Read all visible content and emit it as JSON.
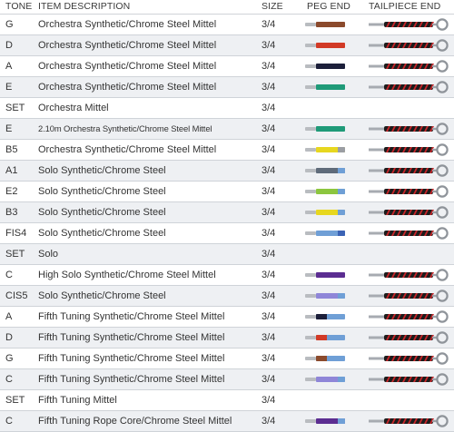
{
  "header": {
    "tone": "TONE",
    "description": "ITEM DESCRIPTION",
    "size": "SIZE",
    "peg_end": "PEG END",
    "tailpiece_end": "TAILPIECE END"
  },
  "rows": [
    {
      "tone": "G",
      "description": "Orchestra Synthetic/Chrome Steel Mittel",
      "size": "3/4",
      "peg": {
        "main": "#8b4a2c"
      },
      "tail": true
    },
    {
      "tone": "D",
      "description": "Orchestra Synthetic/Chrome Steel Mittel",
      "size": "3/4",
      "peg": {
        "main": "#d23a26"
      },
      "tail": true
    },
    {
      "tone": "A",
      "description": "Orchestra Synthetic/Chrome Steel Mittel",
      "size": "3/4",
      "peg": {
        "main": "#1c1f3a"
      },
      "tail": true
    },
    {
      "tone": "E",
      "description": "Orchestra Synthetic/Chrome Steel Mittel",
      "size": "3/4",
      "peg": {
        "main": "#1f9a78"
      },
      "tail": true
    },
    {
      "tone": "SET",
      "description": "Orchestra Mittel",
      "size": "3/4",
      "peg": null,
      "tail": false
    },
    {
      "tone": "E",
      "description": "2.10m Orchestra Synthetic/Chrome Steel Mittel",
      "size": "3/4",
      "small": true,
      "peg": {
        "main": "#1f9a78"
      },
      "tail": true
    },
    {
      "tone": "B5",
      "description": "Orchestra Synthetic/Chrome Steel Mittel",
      "size": "3/4",
      "peg": {
        "main": "#e7d71f",
        "tip": "#9b9ea3"
      },
      "tail": true
    },
    {
      "tone": "A1",
      "description": "Solo Synthetic/Chrome Steel",
      "size": "3/4",
      "peg": {
        "main": "#5f6b7a",
        "tip": "#6f9fd6"
      },
      "tail": true
    },
    {
      "tone": "E2",
      "description": "Solo Synthetic/Chrome Steel",
      "size": "3/4",
      "peg": {
        "main": "#8cc63f",
        "tip": "#6f9fd6"
      },
      "tail": true
    },
    {
      "tone": "B3",
      "description": "Solo Synthetic/Chrome Steel",
      "size": "3/4",
      "peg": {
        "main": "#e7d71f",
        "tip": "#6f9fd6"
      },
      "tail": true
    },
    {
      "tone": "FIS4",
      "description": "Solo Synthetic/Chrome Steel",
      "size": "3/4",
      "peg": {
        "main": "#6f9fd6",
        "tip": "#3b63b5"
      },
      "tail": true
    },
    {
      "tone": "SET",
      "description": "Solo",
      "size": "3/4",
      "peg": null,
      "tail": false
    },
    {
      "tone": "C",
      "description": "High Solo Synthetic/Chrome Steel Mittel",
      "size": "3/4",
      "peg": {
        "main": "#5b2d91"
      },
      "tail": true
    },
    {
      "tone": "CIS5",
      "description": "Solo Synthetic/Chrome Steel",
      "size": "3/4",
      "peg": {
        "main": "#8f86d8",
        "tip": "#6f9fd6"
      },
      "tail": true
    },
    {
      "tone": "A",
      "description": "Fifth Tuning Synthetic/Chrome Steel Mittel",
      "size": "3/4",
      "peg": {
        "main": "#6f9fd6",
        "head": "#1c1f3a"
      },
      "tail": true
    },
    {
      "tone": "D",
      "description": "Fifth Tuning Synthetic/Chrome Steel Mittel",
      "size": "3/4",
      "peg": {
        "main": "#6f9fd6",
        "head": "#d23a26"
      },
      "tail": true
    },
    {
      "tone": "G",
      "description": "Fifth Tuning Synthetic/Chrome Steel Mittel",
      "size": "3/4",
      "peg": {
        "main": "#6f9fd6",
        "head": "#8b4a2c"
      },
      "tail": true
    },
    {
      "tone": "C",
      "description": "Fifth Tuning Synthetic/Chrome Steel Mittel",
      "size": "3/4",
      "peg": {
        "main": "#8f86d8",
        "tip": "#6f9fd6"
      },
      "tail": true
    },
    {
      "tone": "SET",
      "description": "Fifth Tuning Mittel",
      "size": "3/4",
      "peg": null,
      "tail": false
    },
    {
      "tone": "C",
      "description": "Fifth Tuning Rope Core/Chrome Steel Mittel",
      "size": "3/4",
      "peg": {
        "main": "#5b2d91",
        "tip": "#6f9fd6"
      },
      "tail": true
    }
  ]
}
